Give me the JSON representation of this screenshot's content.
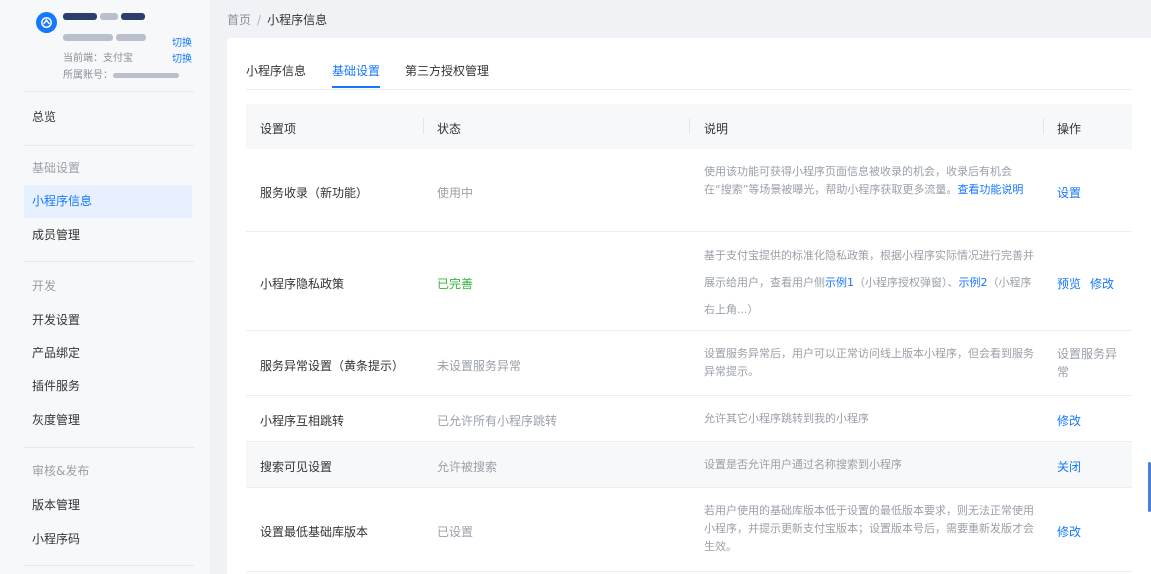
{
  "account": {
    "current_env_label": "当前端：支付宝",
    "account_label": "所属账号：",
    "switch_label": "切换"
  },
  "sidebar": {
    "overview": "总览",
    "groups": [
      {
        "label": "基础设置",
        "items": [
          "小程序信息",
          "成员管理"
        ]
      },
      {
        "label": "开发",
        "items": [
          "开发设置",
          "产品绑定",
          "插件服务",
          "灰度管理"
        ]
      },
      {
        "label": "审核&发布",
        "items": [
          "版本管理",
          "小程序码"
        ]
      }
    ],
    "active_item": "小程序信息"
  },
  "breadcrumb": {
    "home": "首页",
    "separator": "/",
    "current": "小程序信息"
  },
  "tabs": [
    {
      "label": "小程序信息"
    },
    {
      "label": "基础设置",
      "active": true
    },
    {
      "label": "第三方授权管理"
    }
  ],
  "table": {
    "columns": [
      "设置项",
      "状态",
      "说明",
      "操作"
    ],
    "rows": [
      {
        "name": "服务收录（新功能）",
        "status": "使用中",
        "desc": "使用该功能可获得小程序页面信息被收录的机会，收录后有机会在“搜索”等场景被曝光，帮助小程序获取更多流量。",
        "desc_link": "查看功能说明",
        "ops": [
          "设置"
        ]
      },
      {
        "name": "小程序隐私政策",
        "status": "已完善",
        "desc_pre": "基于支付宝提供的标准化隐私政策，根据小程序实际情况进行完善并展示给用户，查看用户侧",
        "desc_link1": "示例1",
        "desc_mid": "（小程序授权弹窗）、",
        "desc_link2": "示例2",
        "desc_post": "（小程序右上角...）",
        "ops": [
          "预览",
          "修改"
        ]
      },
      {
        "name": "服务异常设置（黄条提示）",
        "status": "未设置服务异常",
        "desc": "设置服务异常后，用户可以正常访问线上版本小程序，但会看到服务异常提示。",
        "ops_text": "设置服务异常"
      },
      {
        "name": "小程序互相跳转",
        "status": "已允许所有小程序跳转",
        "desc": "允许其它小程序跳转到我的小程序",
        "ops": [
          "修改"
        ]
      },
      {
        "name": "搜索可见设置",
        "status": "允许被搜索",
        "desc": "设置是否允许用户通过名称搜索到小程序",
        "ops": [
          "关闭"
        ]
      },
      {
        "name": "设置最低基础库版本",
        "status": "已设置",
        "desc": "若用户使用的基础库版本低于设置的最低版本要求，则无法正常使用小程序，并提示更新支付宝版本；设置版本号后，需要重新发版才会生效。",
        "ops": [
          "修改"
        ]
      }
    ]
  }
}
